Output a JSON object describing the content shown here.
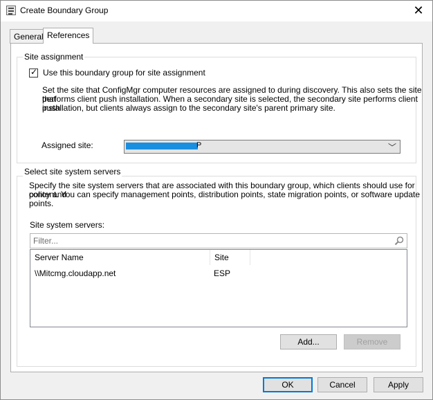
{
  "window": {
    "title": "Create Boundary Group",
    "close_glyph": "✕"
  },
  "tabs": [
    {
      "label": "General",
      "active": false
    },
    {
      "label": "References",
      "active": true
    }
  ],
  "site_assignment": {
    "group_label": "Site assignment",
    "checkbox_label": "Use this boundary group for site assignment",
    "checked": true,
    "description_lines": [
      "Set the site that ConfigMgr computer resources are assigned to during discovery. This also sets the site that",
      "performs client push installation. When a secondary site is selected, the secondary site performs client push",
      "installation, but clients always assign to the secondary site's parent primary site."
    ],
    "assigned_site_label": "Assigned site:",
    "assigned_site_value": "P"
  },
  "site_system_servers": {
    "group_label": "Select site system servers",
    "description_lines": [
      "Specify the site system servers that are associated with this boundary group, which clients should use for policy and",
      "content. You can specify management points, distribution points, state migration points, or software update points."
    ],
    "list_label": "Site system servers:",
    "filter_placeholder": "Filter...",
    "columns": [
      "Server Name",
      "Site"
    ],
    "rows": [
      {
        "server": "\\\\Mitcmg.cloudapp.net",
        "site": "ESP"
      }
    ],
    "add_label": "Add...",
    "remove_label": "Remove"
  },
  "footer": {
    "ok_label": "OK",
    "cancel_label": "Cancel",
    "apply_label": "Apply"
  }
}
